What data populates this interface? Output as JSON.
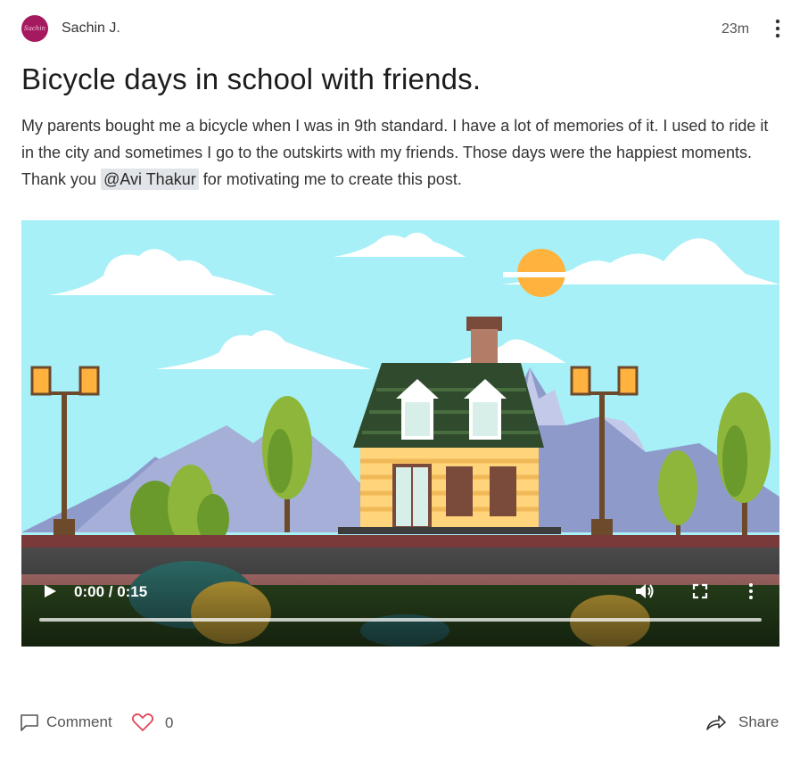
{
  "post": {
    "author": {
      "avatar_text": "Sachin",
      "name": "Sachin J."
    },
    "timestamp": "23m",
    "title": "Bicycle days in school with friends.",
    "body_before": "My parents bought me a bicycle when I was in 9th standard. I have a lot of memories of it. I used to ride it in the city and sometimes I go to the outskirts with my friends. Those days were the happiest moments. Thank you ",
    "mention": "@Avi Thakur",
    "body_after": " for motivating me to create this post."
  },
  "video": {
    "time_display": "0:00 / 0:15",
    "progress": 0,
    "icons": [
      "play-icon",
      "volume-icon",
      "fullscreen-icon",
      "more-vertical-icon"
    ]
  },
  "footer": {
    "comment_label": "Comment",
    "like_count": "0",
    "share_label": "Share"
  },
  "colors": {
    "avatar_bg": "#a5195f",
    "heart": "#e0465a",
    "mention_bg": "#e1e4e8",
    "sky": "#a7f0f7"
  }
}
